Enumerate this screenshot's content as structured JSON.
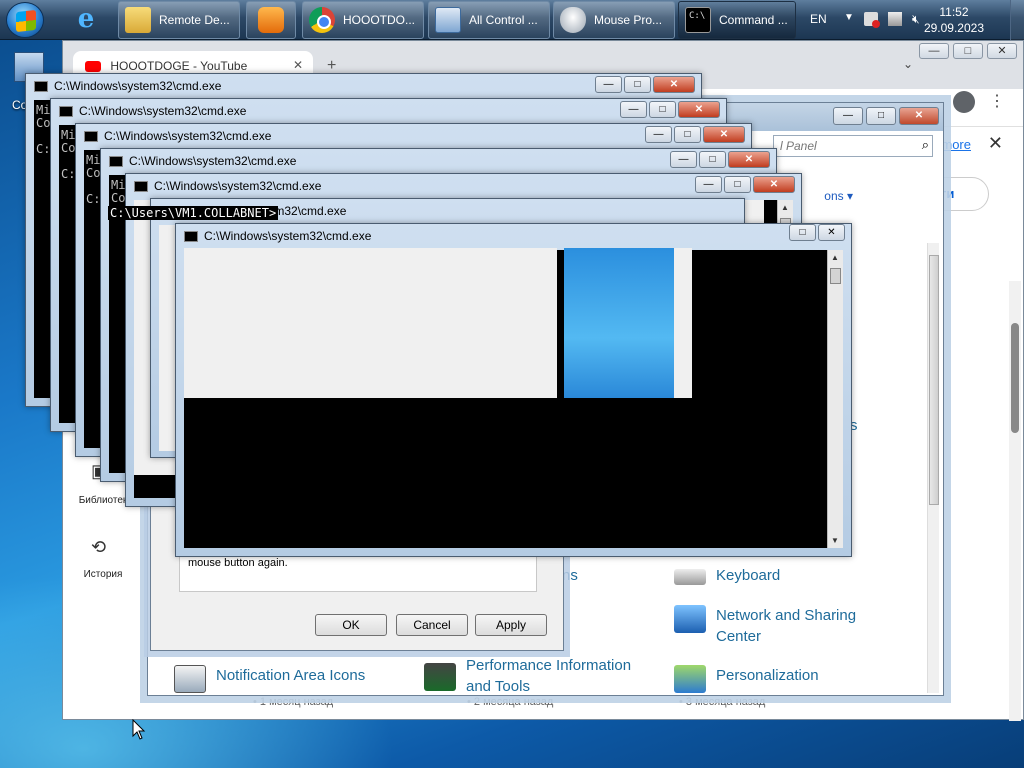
{
  "taskbar": {
    "buttons": [
      {
        "label": "Remote De...",
        "icon": "folder-icon"
      },
      {
        "label": "",
        "icon": "media-player-icon"
      },
      {
        "label": "HOOOTDO...",
        "icon": "chrome-icon"
      },
      {
        "label": "All Control ...",
        "icon": "control-panel-icon"
      },
      {
        "label": "Mouse Pro...",
        "icon": "mouse-icon"
      },
      {
        "label": "Command ...",
        "icon": "cmd-icon"
      }
    ],
    "lang": "EN",
    "time": "11:52",
    "date": "29.09.2023"
  },
  "desktop": {
    "icon_label": "Co"
  },
  "chrome": {
    "tab_title": "HOOOTDOGE - YouTube",
    "more_link": "more",
    "signin_label": "йти",
    "sidebar": [
      {
        "label": "Библиотек",
        "icon": "library-icon"
      },
      {
        "label": "История",
        "icon": "history-icon"
      }
    ],
    "meta": [
      "• 1 месяц назад",
      "• 2 месяца назад",
      "• 3 месяца назад"
    ]
  },
  "control_panel": {
    "search_placeholder": "l Panel",
    "view_by": "ons ▾",
    "items": [
      {
        "label": "Notification Area Icons",
        "icon": "notification-area-icon"
      },
      {
        "label": "Performance Information and Tools",
        "icon": "performance-icon"
      },
      {
        "label": "Personalization",
        "icon": "personalization-icon"
      },
      {
        "label": "Keyboard",
        "icon": "keyboard-icon"
      },
      {
        "label": "Network and Sharing Center",
        "icon": "network-icon"
      }
    ],
    "partial_labels": [
      "ns",
      "s",
      "r"
    ]
  },
  "mouse_properties": {
    "text": "mouse button again.",
    "ok_label": "OK",
    "cancel_label": "Cancel",
    "apply_label": "Apply"
  },
  "cmd": {
    "title": "C:\\Windows\\system32\\cmd.exe",
    "snippet_lines": [
      "Mi",
      "Co",
      "",
      "C:"
    ],
    "prompt": "C:\\Users\\VM1.COLLABNET>"
  },
  "colors": {
    "accent": "#1e6b9a",
    "link": "#1a73e8",
    "close_red": "#c13d20"
  }
}
